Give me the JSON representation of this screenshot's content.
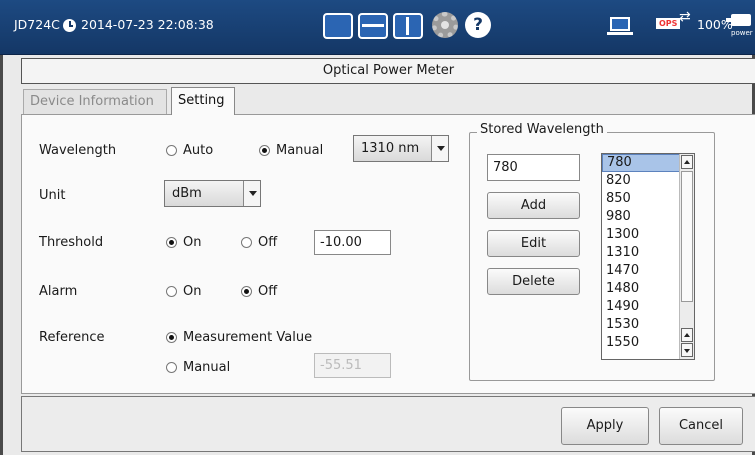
{
  "status_bar": {
    "model": "JD724C",
    "datetime": "2014-07-23 22:08:38",
    "battery": "100%",
    "power_label": "power",
    "ops_label": "OPS",
    "icons": [
      "clock-icon",
      "single-view-icon",
      "split-horizontal-icon",
      "split-vertical-icon",
      "gear-icon",
      "help-icon",
      "laptop-icon",
      "ops-icon",
      "plug-icon"
    ]
  },
  "window": {
    "title": "Optical Power Meter"
  },
  "tabs": [
    {
      "label": "Device Information",
      "active": false
    },
    {
      "label": "Setting",
      "active": true
    }
  ],
  "settings": {
    "wavelength": {
      "label": "Wavelength",
      "options": [
        "Auto",
        "Manual"
      ],
      "selected": "Manual",
      "value": "1310 nm"
    },
    "unit": {
      "label": "Unit",
      "value": "dBm"
    },
    "threshold": {
      "label": "Threshold",
      "options": [
        "On",
        "Off"
      ],
      "selected": "On",
      "value": "-10.00"
    },
    "alarm": {
      "label": "Alarm",
      "options": [
        "On",
        "Off"
      ],
      "selected": "Off"
    },
    "reference": {
      "label": "Reference",
      "options": [
        "Measurement Value",
        "Manual"
      ],
      "selected": "Measurement Value",
      "manual_value": "-55.51"
    }
  },
  "stored_wavelength": {
    "title": "Stored Wavelength",
    "input_value": "780",
    "buttons": {
      "add": "Add",
      "edit": "Edit",
      "delete": "Delete"
    },
    "items": [
      "780",
      "820",
      "850",
      "980",
      "1300",
      "1310",
      "1470",
      "1480",
      "1490",
      "1530",
      "1550"
    ],
    "selected": "780"
  },
  "footer": {
    "apply": "Apply",
    "cancel": "Cancel"
  },
  "colors": {
    "status_bar": "#143766",
    "selection": "#a9c4e8"
  }
}
